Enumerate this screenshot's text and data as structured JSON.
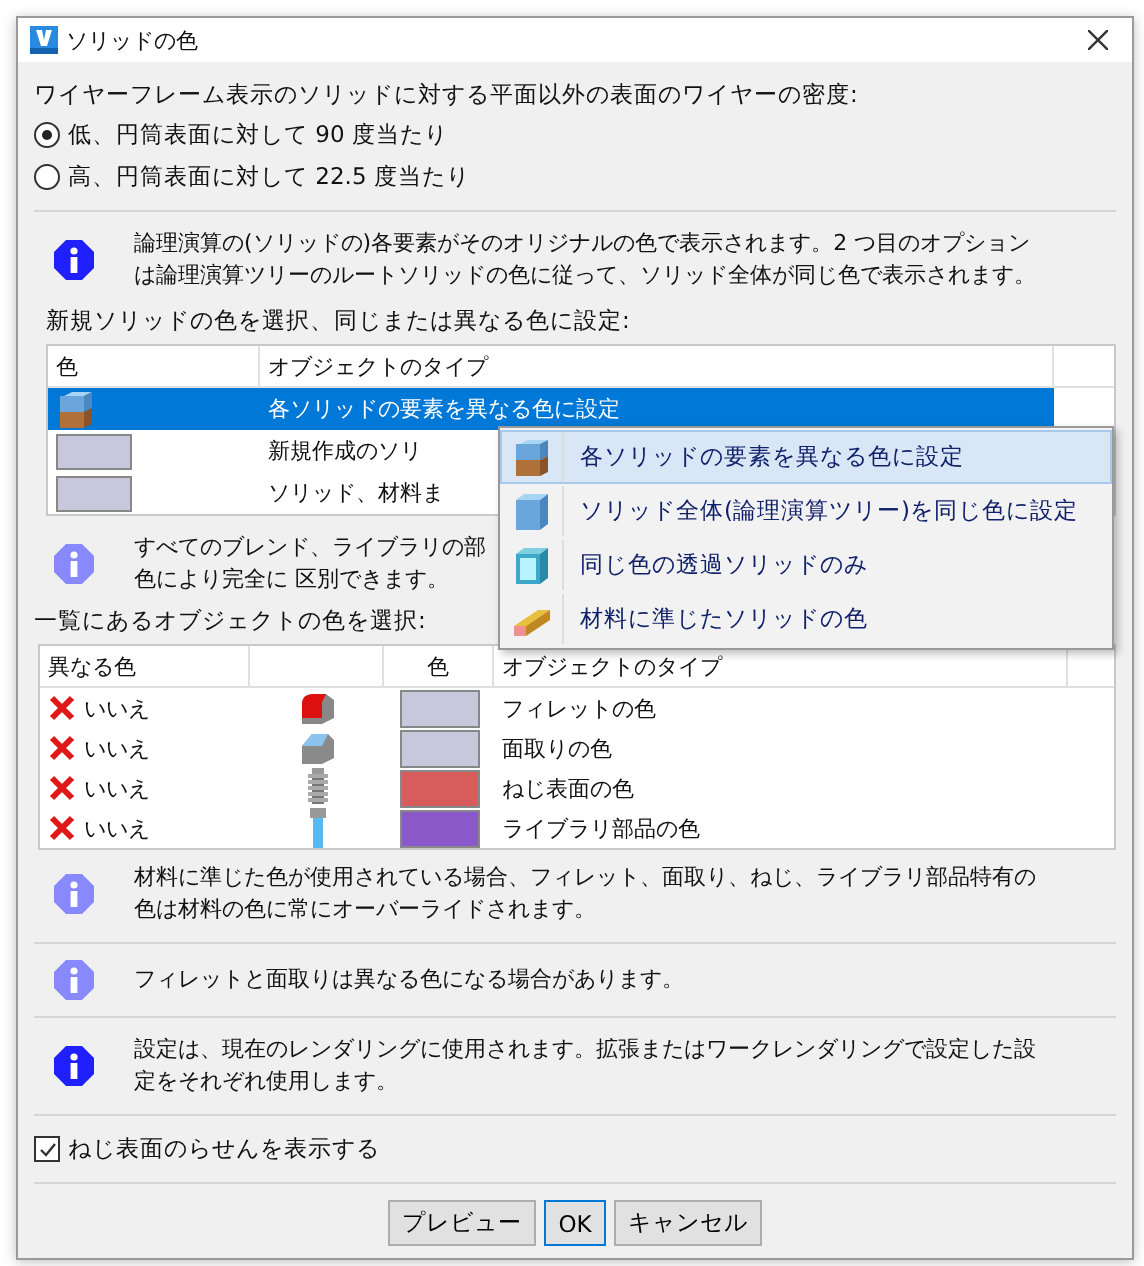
{
  "window": {
    "title": "ソリッドの色"
  },
  "wire_density": {
    "label": "ワイヤーフレーム表示のソリッドに対する平面以外の表面のワイヤーの密度:",
    "options": [
      {
        "label": "低、円筒表面に対して 90 度当たり",
        "selected": true
      },
      {
        "label": "高、円筒表面に対して 22.5 度当たり",
        "selected": false
      }
    ]
  },
  "note_boolean": {
    "strong": true,
    "lines": [
      "論理演算の(ソリッドの)各要素がそのオリジナルの色で表示されます。2 つ目のオプション",
      "は論理演算ツリーのルートソリッドの色に従って、ソリッド全体が同じ色で表示されます。"
    ]
  },
  "new_solid": {
    "label": "新規ソリッドの色を選択、同じまたは異なる色に設定:",
    "columns": {
      "color_header": "色",
      "type": "オブジェクトのタイプ"
    },
    "rows": [
      {
        "kind": "split-cube",
        "type": "各ソリッドの要素を異なる色に設定",
        "selected": true
      },
      {
        "kind": "swatch",
        "color": "#c8c8dc",
        "type": "新規作成のソリ",
        "selected": false
      },
      {
        "kind": "swatch",
        "color": "#c8c8dc",
        "type": "ソリッド、材料ま",
        "selected": false
      }
    ],
    "dropdown": [
      {
        "kind": "split-cube",
        "label": "各ソリッドの要素を異なる色に設定",
        "selected": true
      },
      {
        "kind": "cube",
        "label": "ソリッド全体(論理演算ツリー)を同じ色に設定",
        "selected": false
      },
      {
        "kind": "clear-cube",
        "label": "同じ色の透過ソリッドのみ",
        "selected": false
      },
      {
        "kind": "material-bar",
        "label": "材料に準じたソリッドの色",
        "selected": false
      }
    ]
  },
  "note_blend": {
    "strong": false,
    "lines": [
      "すべてのブレンド、ライブラリの部",
      "色により完全に 区別できます。"
    ]
  },
  "objects": {
    "label": "一覧にあるオブジェクトの色を選択:",
    "columns": {
      "different": "異なる色",
      "color_header": "色",
      "type": "オブジェクトのタイプ"
    },
    "rows": [
      {
        "different": "いいえ",
        "on": false,
        "kind": "fillet",
        "color": "#c8c8dc",
        "type": "フィレットの色"
      },
      {
        "different": "いいえ",
        "on": false,
        "kind": "chamfer",
        "color": "#c8c8dc",
        "type": "面取りの色"
      },
      {
        "different": "いいえ",
        "on": false,
        "kind": "thread",
        "color": "#d85c5c",
        "type": "ねじ表面の色"
      },
      {
        "different": "いいえ",
        "on": false,
        "kind": "library-part",
        "color": "#8a58c8",
        "type": "ライブラリ部品の色"
      }
    ]
  },
  "note_material": {
    "strong": false,
    "lines": [
      "材料に準じた色が使用されている場合、フィレット、面取り、ねじ、ライブラリ部品特有の",
      "色は材料の色に常にオーバーライドされます。"
    ]
  },
  "note_fillet": {
    "strong": false,
    "lines": [
      "フィレットと面取りは異なる色になる場合があります。"
    ]
  },
  "note_settings": {
    "strong": true,
    "lines": [
      "設定は、現在のレンダリングに使用されます。拡張またはワークレンダリングで設定した設",
      "定をそれぞれ使用します。"
    ]
  },
  "thread_helix": {
    "label": "ねじ表面のらせんを表示する",
    "checked": true
  },
  "buttons": [
    {
      "label": "プレビュー",
      "default": false
    },
    {
      "label": "OK",
      "default": true
    },
    {
      "label": "キャンセル",
      "default": false
    }
  ]
}
